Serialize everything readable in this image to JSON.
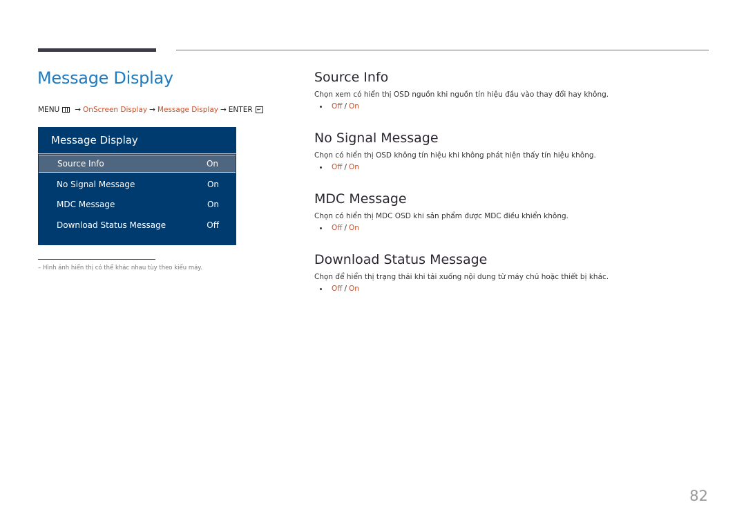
{
  "page": {
    "title": "Message Display",
    "number": "82",
    "accent_color": "#1f7bc1",
    "link_color": "#c8502a"
  },
  "breadcrumb": {
    "menu_label": "MENU",
    "menu_icon": "menu-icon",
    "arrow": "→",
    "step1": "OnScreen Display",
    "step2": "Message Display",
    "enter_label": "ENTER",
    "enter_icon": "enter-icon",
    "enter_glyph": "↵"
  },
  "osd": {
    "title": "Message Display",
    "items": [
      {
        "label": "Source Info",
        "value": "On",
        "selected": true
      },
      {
        "label": "No Signal Message",
        "value": "On",
        "selected": false
      },
      {
        "label": "MDC Message",
        "value": "On",
        "selected": false
      },
      {
        "label": "Download Status Message",
        "value": "Off",
        "selected": false
      }
    ]
  },
  "footnote": "–  Hình ảnh hiển thị có thể khác nhau tùy theo kiểu máy.",
  "sections": [
    {
      "heading": "Source Info",
      "description": "Chọn xem có hiển thị OSD nguồn khi nguồn tín hiệu đầu vào thay đổi hay không.",
      "options": [
        "Off",
        "On"
      ],
      "separator": "/"
    },
    {
      "heading": "No Signal Message",
      "description": "Chọn có hiển thị OSD không tín hiệu khi không phát hiện thấy tín hiệu không.",
      "options": [
        "Off",
        "On"
      ],
      "separator": "/"
    },
    {
      "heading": "MDC Message",
      "description": "Chọn có hiển thị MDC OSD khi sản phẩm được MDC điều khiển không.",
      "options": [
        "Off",
        "On"
      ],
      "separator": "/"
    },
    {
      "heading": "Download Status Message",
      "description": "Chọn để hiển thị trạng thái khi tải xuống nội dung từ máy chủ hoặc thiết bị khác.",
      "options": [
        "Off",
        "On"
      ],
      "separator": "/"
    }
  ]
}
